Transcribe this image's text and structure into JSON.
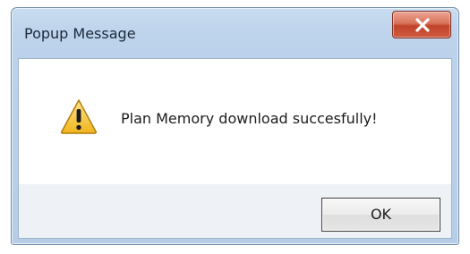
{
  "window": {
    "title": "Popup Message",
    "close_icon": "close-x-icon"
  },
  "message": {
    "icon": "warning-icon",
    "text": "Plan Memory download succesfully!"
  },
  "buttons": {
    "ok_label": "OK"
  },
  "colors": {
    "title_bar": "#bdd3ec",
    "close_button": "#c0442a",
    "warning_fill": "#f5c542",
    "button_area": "#eef2f6"
  }
}
